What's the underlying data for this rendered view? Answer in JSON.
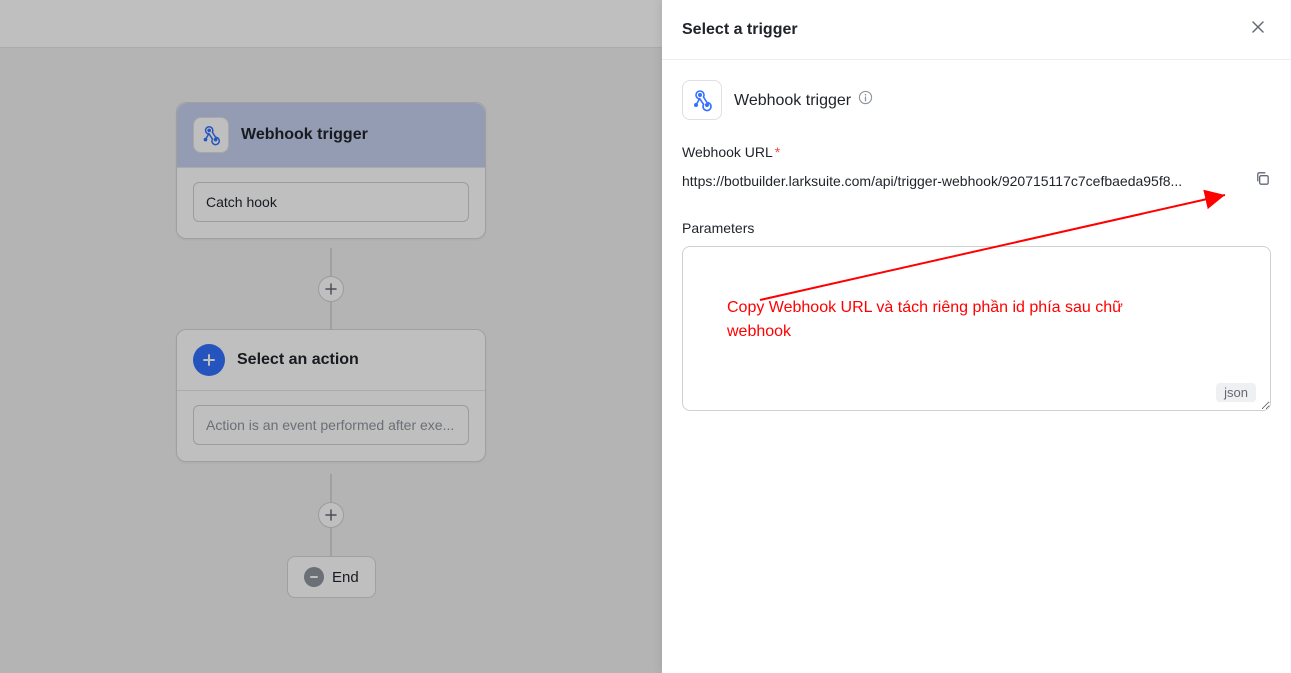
{
  "canvas": {
    "trigger_node": {
      "title": "Webhook trigger",
      "input_value": "Catch hook"
    },
    "action_node": {
      "title": "Select an action",
      "input_placeholder": "Action is an event performed after exe..."
    },
    "end_node": {
      "label": "End"
    }
  },
  "panel": {
    "title": "Select a trigger",
    "trigger_name": "Webhook trigger",
    "webhook_url_label": "Webhook URL",
    "webhook_url_value": "https://botbuilder.larksuite.com/api/trigger-webhook/920715117c7cefbaeda95f8...",
    "parameters_label": "Parameters",
    "json_badge": "json"
  },
  "annotation": {
    "text": "Copy Webhook URL và tách riêng phần id phía sau chữ webhook"
  },
  "icons": {
    "webhook": "webhook-icon",
    "plus": "plus-icon",
    "close": "close-icon",
    "info": "info-icon",
    "copy": "copy-icon",
    "minus": "minus-icon"
  }
}
